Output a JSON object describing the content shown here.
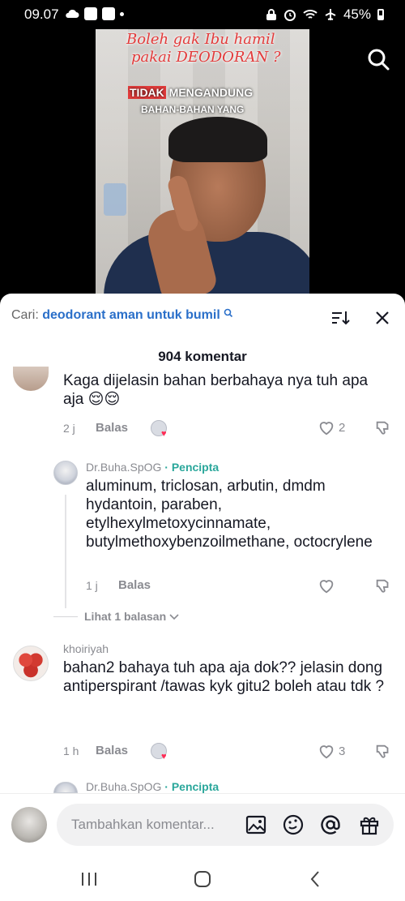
{
  "status_bar": {
    "time": "09.07",
    "battery": "45%"
  },
  "video": {
    "caption_line1": "Boleh gak Ibu hamil",
    "caption_line2": "pakai DEODORAN ?",
    "caption_red": "TIDAK",
    "caption_bold": " MENGANDUNG",
    "caption_small": "BAHAN-BAHAN YANG"
  },
  "comments_panel": {
    "search_prefix": "Cari:",
    "search_query": "deodorant aman untuk bumil",
    "count_label": "904 komentar"
  },
  "comments": [
    {
      "text": "Kaga dijelasin bahan berbahaya nya tuh apa aja 😌😌",
      "time": "2 j",
      "reply_label": "Balas",
      "likes": "2"
    },
    {
      "username": "Dr.Buha.SpOG",
      "creator_label": "· Pencipta",
      "text": "aluminum, triclosan, arbutin, dmdm hydantoin, paraben, etylhexylmetoxycinnamate, butylmethoxybenzoilmethane, octocrylene",
      "time": "1 j",
      "reply_label": "Balas",
      "more_replies": "Lihat 1 balasan"
    },
    {
      "username": "khoiriyah",
      "text": "bahan2 bahaya tuh apa aja dok?? jelasin dong antiperspirant /tawas kyk gitu2 boleh atau tdk ?",
      "time": "1 h",
      "reply_label": "Balas",
      "likes": "3"
    },
    {
      "username": "Dr.Buha.SpOG",
      "creator_label": "· Pencipta"
    }
  ],
  "input": {
    "placeholder": "Tambahkan komentar..."
  },
  "colors": {
    "accent_link": "#2a6fc9",
    "creator": "#2aa79b",
    "like": "#fe2c55"
  }
}
